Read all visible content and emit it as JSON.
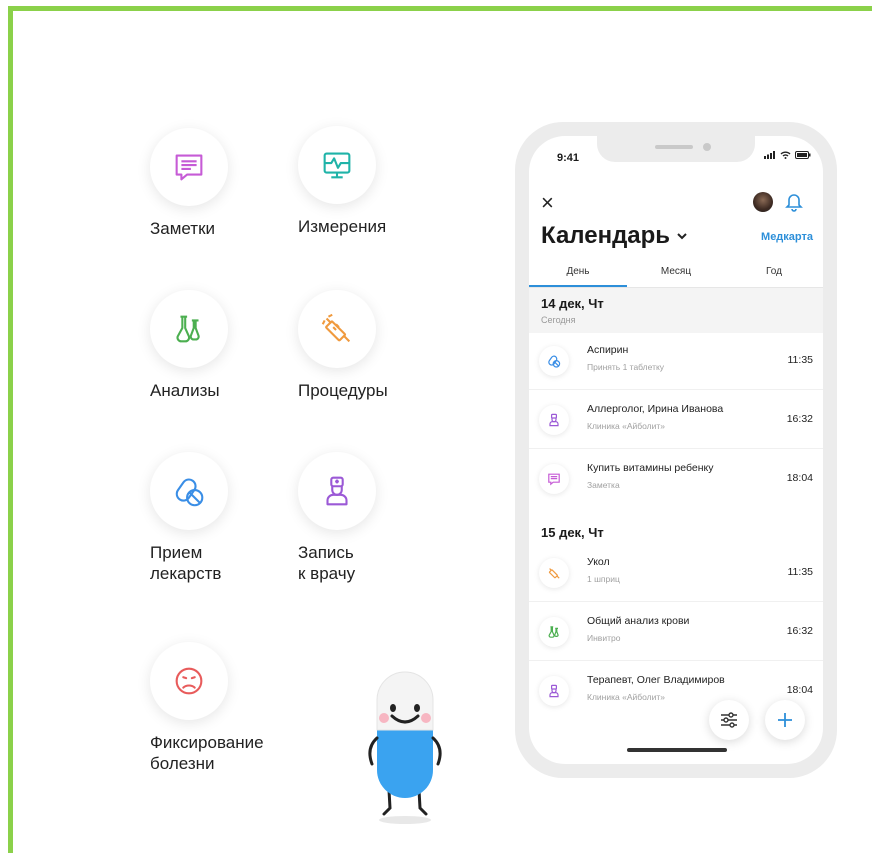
{
  "features": [
    {
      "id": "notes",
      "label": "Заметки",
      "icon": "notes-icon",
      "color": "#c65bd6"
    },
    {
      "id": "measurements",
      "label": "Измерения",
      "icon": "monitor-icon",
      "color": "#1fb3a8"
    },
    {
      "id": "analyses",
      "label": "Анализы",
      "icon": "flask-icon",
      "color": "#4caf50"
    },
    {
      "id": "procedures",
      "label": "Процедуры",
      "icon": "syringe-icon",
      "color": "#f09a3e"
    },
    {
      "id": "medication",
      "label": "Прием\nлекарств",
      "icon": "pills-icon",
      "color": "#3a8ee6"
    },
    {
      "id": "appointment",
      "label": "Запись\nк врачу",
      "icon": "doctor-icon",
      "color": "#9b59d6"
    },
    {
      "id": "illness",
      "label": "Фиксирование\nболезни",
      "icon": "sad-face-icon",
      "color": "#e85b5b"
    }
  ],
  "phone": {
    "status_time": "9:41",
    "title": "Календарь",
    "medcard_link": "Медкарта",
    "tabs": [
      "День",
      "Месяц",
      "Год"
    ],
    "active_tab": "День",
    "accent": "#2d8fd9",
    "days": [
      {
        "date": "14 дек, Чт",
        "subtitle": "Сегодня",
        "events": [
          {
            "title": "Аспирин",
            "subtitle": "Принять 1 таблетку",
            "time": "11:35",
            "icon": "pills-icon"
          },
          {
            "title": "Аллерголог, Ирина Иванова",
            "subtitle": "Клиника «Айболит»",
            "time": "16:32",
            "icon": "doctor-icon"
          },
          {
            "title": "Купить витамины ребенку",
            "subtitle": "Заметка",
            "time": "18:04",
            "icon": "notes-icon"
          }
        ]
      },
      {
        "date": "15 дек, Чт",
        "subtitle": "",
        "events": [
          {
            "title": "Укол",
            "subtitle": "1 шприц",
            "time": "11:35",
            "icon": "syringe-icon"
          },
          {
            "title": "Общий анализ крови",
            "subtitle": "Инвитро",
            "time": "16:32",
            "icon": "flask-icon"
          },
          {
            "title": "Терапевт, Олег Владимиров",
            "subtitle": "Клиника «Айболит»",
            "time": "18:04",
            "icon": "doctor-icon"
          }
        ]
      }
    ]
  }
}
